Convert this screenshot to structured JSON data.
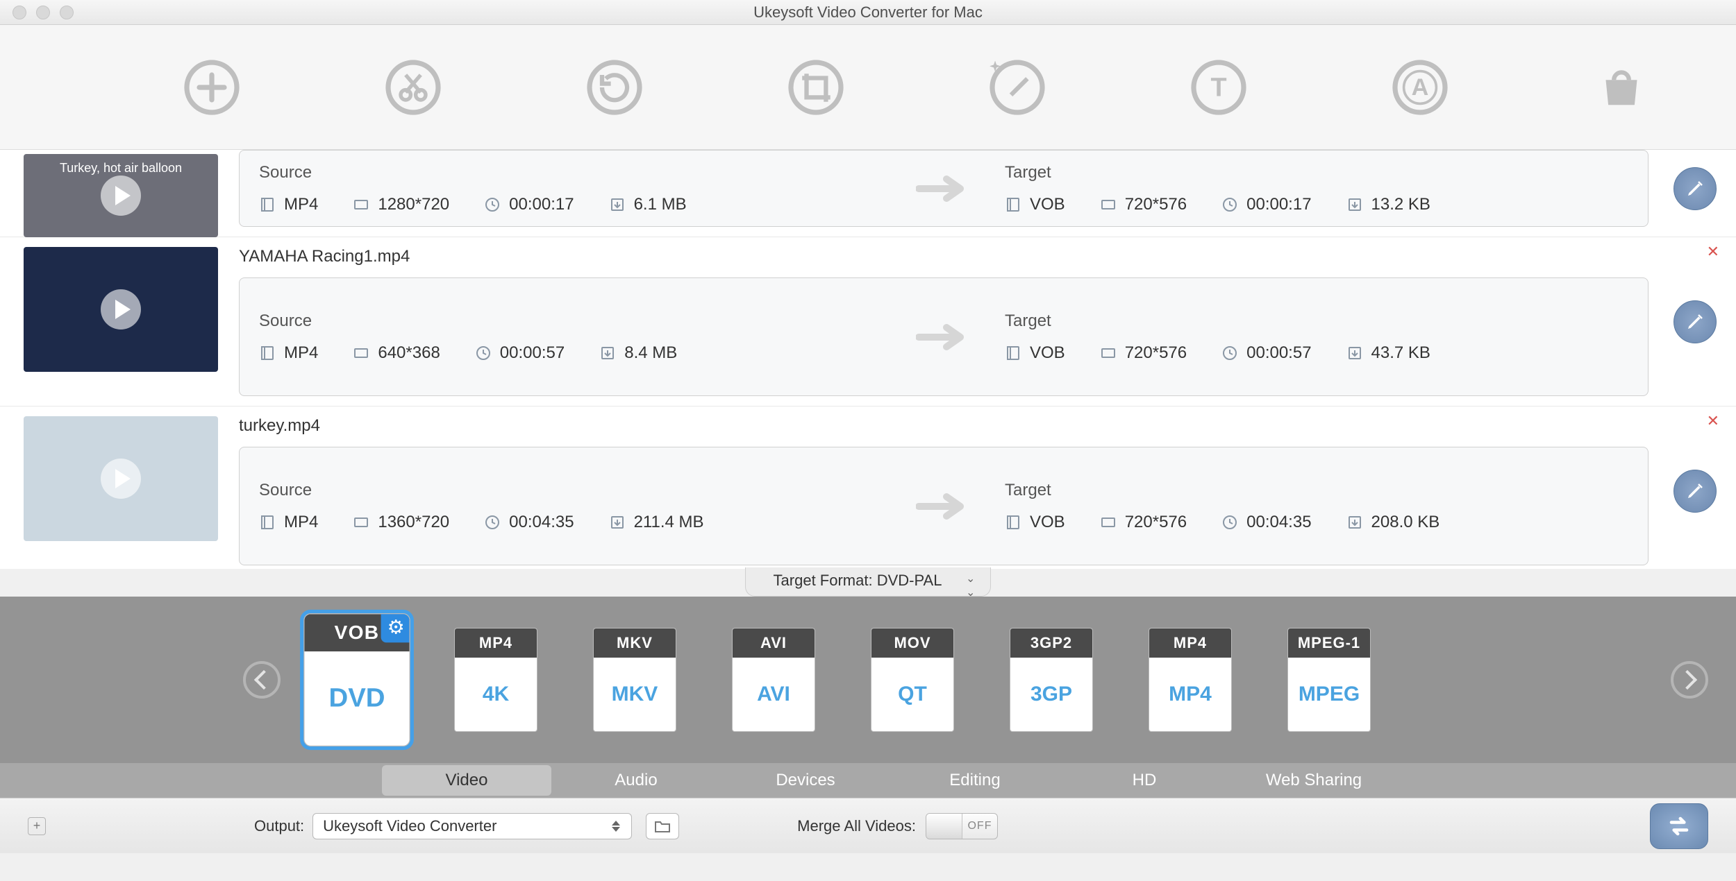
{
  "window": {
    "title": "Ukeysoft Video Converter for Mac"
  },
  "toolbar_icons": [
    "add",
    "trim",
    "rotate",
    "crop",
    "effect",
    "text",
    "watermark",
    "shop"
  ],
  "labels": {
    "source": "Source",
    "target": "Target"
  },
  "items": [
    {
      "filename": "",
      "thumb_label": "Turkey, hot air balloon",
      "thumb_bg": "#6d6e78",
      "source": {
        "format": "MP4",
        "resolution": "1280*720",
        "duration": "00:00:17",
        "size": "6.1 MB"
      },
      "target": {
        "format": "VOB",
        "resolution": "720*576",
        "duration": "00:00:17",
        "size": "13.2 KB"
      },
      "removable": false
    },
    {
      "filename": "YAMAHA Racing1.mp4",
      "thumb_label": "",
      "thumb_bg": "#1d2a4a",
      "source": {
        "format": "MP4",
        "resolution": "640*368",
        "duration": "00:00:57",
        "size": "8.4 MB"
      },
      "target": {
        "format": "VOB",
        "resolution": "720*576",
        "duration": "00:00:57",
        "size": "43.7 KB"
      },
      "removable": true
    },
    {
      "filename": "turkey.mp4",
      "thumb_label": "",
      "thumb_bg": "#cbd7e0",
      "source": {
        "format": "MP4",
        "resolution": "1360*720",
        "duration": "00:04:35",
        "size": "211.4 MB"
      },
      "target": {
        "format": "VOB",
        "resolution": "720*576",
        "duration": "00:04:35",
        "size": "208.0 KB"
      },
      "removable": true
    }
  ],
  "target_format": {
    "label": "Target Format: DVD-PAL"
  },
  "shelf": {
    "formats": [
      {
        "code": "VOB",
        "sub": "DVD",
        "selected": true
      },
      {
        "code": "MP4",
        "sub": "4K",
        "selected": false
      },
      {
        "code": "MKV",
        "sub": "MKV",
        "selected": false
      },
      {
        "code": "AVI",
        "sub": "AVI",
        "selected": false
      },
      {
        "code": "MOV",
        "sub": "QT",
        "selected": false
      },
      {
        "code": "3GP2",
        "sub": "3GP",
        "selected": false
      },
      {
        "code": "MP4",
        "sub": "MP4",
        "selected": false
      },
      {
        "code": "MPEG-1",
        "sub": "MPEG",
        "selected": false
      }
    ]
  },
  "categories": {
    "items": [
      "Video",
      "Audio",
      "Devices",
      "Editing",
      "HD",
      "Web Sharing"
    ],
    "active": "Video"
  },
  "footer": {
    "output_label": "Output:",
    "output_value": "Ukeysoft Video Converter",
    "merge_label": "Merge All Videos:",
    "merge_state": "OFF"
  }
}
